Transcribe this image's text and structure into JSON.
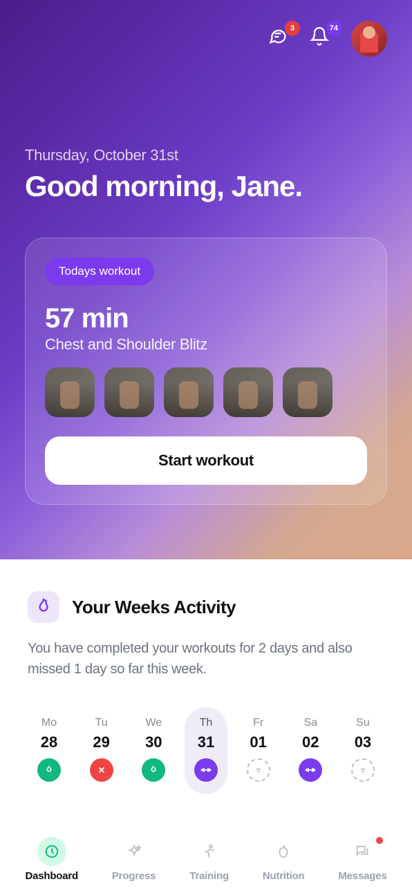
{
  "header": {
    "messages_badge": "3",
    "notifications_badge": "74"
  },
  "hero": {
    "date": "Thursday, October 31st",
    "greeting": "Good morning, Jane.",
    "workout": {
      "pill": "Todays workout",
      "duration": "57 min",
      "name": "Chest and Shoulder Blitz",
      "cta": "Start workout"
    }
  },
  "activity": {
    "title": "Your Weeks Activity",
    "description": "You have completed your workouts for 2 days and also missed 1 day so far this week.",
    "days": [
      {
        "abbr": "Mo",
        "num": "28",
        "status": "done"
      },
      {
        "abbr": "Tu",
        "num": "29",
        "status": "missed"
      },
      {
        "abbr": "We",
        "num": "30",
        "status": "done"
      },
      {
        "abbr": "Th",
        "num": "31",
        "status": "current"
      },
      {
        "abbr": "Fr",
        "num": "01",
        "status": "rest"
      },
      {
        "abbr": "Sa",
        "num": "02",
        "status": "planned"
      },
      {
        "abbr": "Su",
        "num": "03",
        "status": "rest"
      }
    ]
  },
  "tabs": {
    "dashboard": "Dashboard",
    "progress": "Progress",
    "training": "Training",
    "nutrition": "Nutrition",
    "messages": "Messages"
  }
}
